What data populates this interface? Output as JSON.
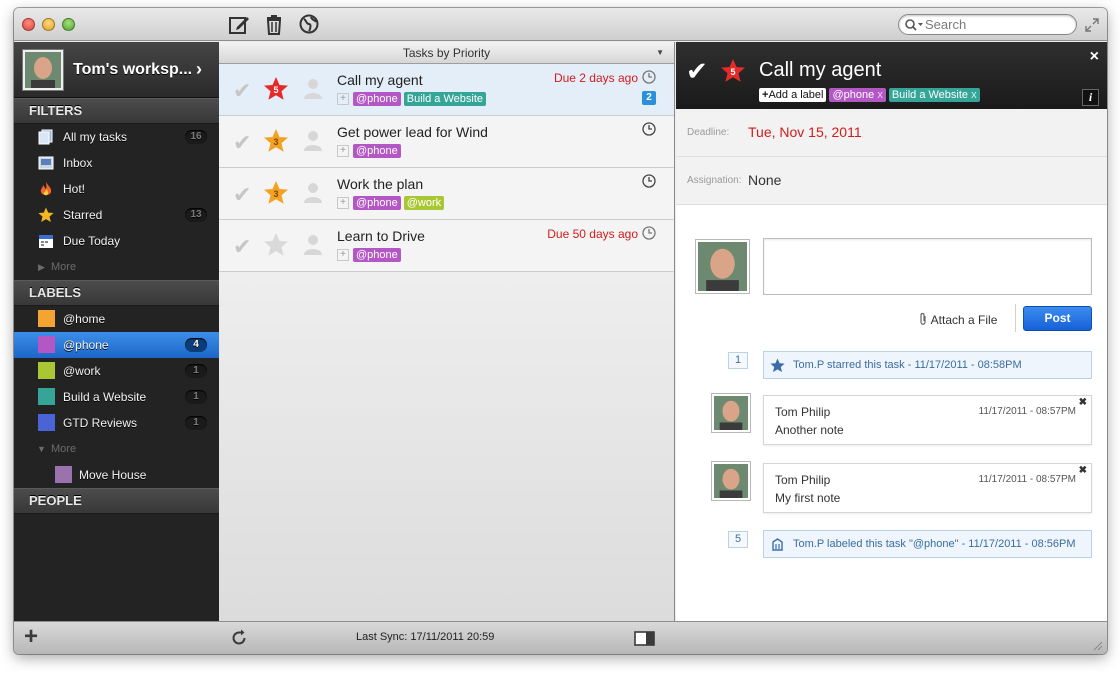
{
  "toolbar": {
    "search_placeholder": "Search"
  },
  "sidebar": {
    "workspace_name": "Tom's worksp...",
    "filters_heading": "FILTERS",
    "filters": [
      {
        "label": "All my tasks",
        "count": "16"
      },
      {
        "label": "Inbox",
        "count": ""
      },
      {
        "label": "Hot!",
        "count": ""
      },
      {
        "label": "Starred",
        "count": "13"
      },
      {
        "label": "Due Today",
        "count": ""
      }
    ],
    "filters_more": "More",
    "labels_heading": "LABELS",
    "labels": [
      {
        "label": "@home",
        "count": "",
        "color": "#f5a431"
      },
      {
        "label": "@phone",
        "count": "4",
        "color": "#b357c4"
      },
      {
        "label": "@work",
        "count": "1",
        "color": "#a9c734"
      },
      {
        "label": "Build a Website",
        "count": "1",
        "color": "#35a598"
      },
      {
        "label": "GTD Reviews",
        "count": "1",
        "color": "#4a64d6"
      }
    ],
    "labels_more": "More",
    "sub_labels": [
      {
        "label": "Move House",
        "color": "#9a72ad"
      }
    ],
    "people_heading": "PEOPLE"
  },
  "list": {
    "header": "Tasks by Priority",
    "tasks": [
      {
        "title": "Call my agent",
        "priority": "5",
        "due": "Due 2 days ago",
        "count": "2",
        "labels": [
          "@phone",
          "Build a Website"
        ]
      },
      {
        "title": "Get power lead for Wind",
        "priority": "3",
        "due": "",
        "count": "",
        "labels": [
          "@phone"
        ]
      },
      {
        "title": "Work the plan",
        "priority": "3",
        "due": "",
        "count": "",
        "labels": [
          "@phone",
          "@work"
        ]
      },
      {
        "title": "Learn to Drive",
        "priority": "",
        "due": "Due 50 days ago",
        "count": "",
        "labels": [
          "@phone"
        ]
      }
    ]
  },
  "detail": {
    "title": "Call my agent",
    "priority": "5",
    "add_label": "Add a label",
    "labels": [
      {
        "name": "@phone",
        "remove": "x"
      },
      {
        "name": "Build a Website",
        "remove": "x"
      }
    ],
    "close_glyph": "×",
    "info_glyph": "i",
    "deadline_key": "Deadline:",
    "deadline_value": "Tue, Nov 15, 2011",
    "assignation_key": "Assignation:",
    "assignation_value": "None",
    "attach_label": "Attach a File",
    "post_label": "Post",
    "events": [
      {
        "no": "1",
        "text": "Tom.P starred this task - 11/17/2011 - 08:58PM"
      },
      {
        "no": "5",
        "text": "Tom.P labeled this task \"@phone\" - 11/17/2011 - 08:56PM"
      }
    ],
    "comments": [
      {
        "author": "Tom Philip",
        "time": "11/17/2011 - 08:57PM",
        "text": "Another note"
      },
      {
        "author": "Tom Philip",
        "time": "11/17/2011 - 08:57PM",
        "text": "My first note"
      }
    ]
  },
  "status": {
    "last_sync": "Last Sync: 17/11/2011 20:59"
  },
  "colors": {
    "selection_blue": "#1d66c7",
    "due_red": "#d21c1c",
    "post_blue": "#1f6fe0",
    "star_red": "#e52a2a",
    "star_orange": "#f4a224"
  }
}
